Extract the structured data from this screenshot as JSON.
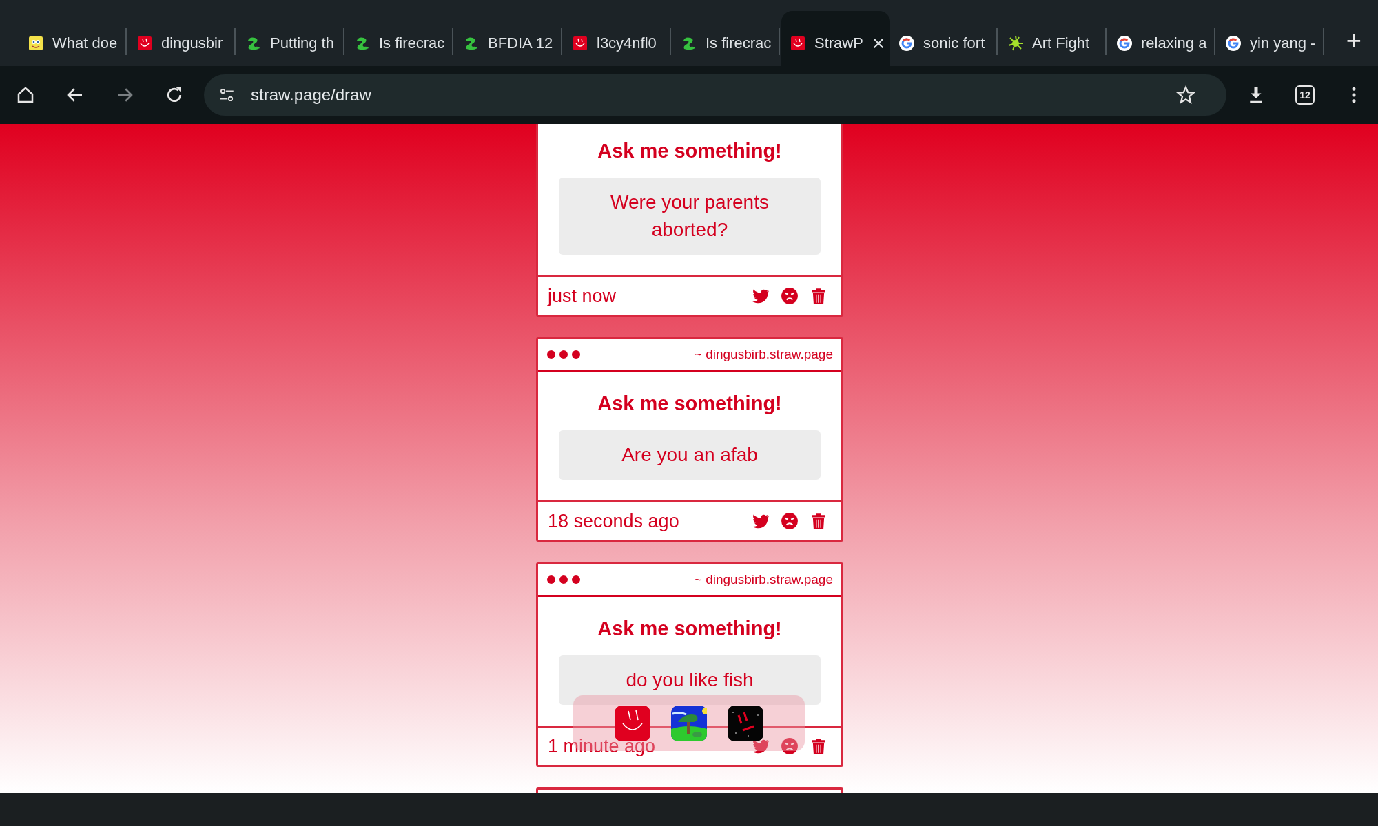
{
  "browser": {
    "tabs": [
      {
        "title": "What doe",
        "kind": "sponge",
        "selected": false
      },
      {
        "title": "dingusbir",
        "kind": "straw",
        "selected": false
      },
      {
        "title": "Putting th",
        "kind": "blob",
        "selected": false
      },
      {
        "title": "Is firecrac",
        "kind": "blob",
        "selected": false
      },
      {
        "title": "BFDIA 12",
        "kind": "blob",
        "selected": false
      },
      {
        "title": "l3cy4nfl0",
        "kind": "straw",
        "selected": false
      },
      {
        "title": "Is firecrac",
        "kind": "blob",
        "selected": false
      },
      {
        "title": "StrawP",
        "kind": "straw",
        "selected": true
      },
      {
        "title": "sonic fort",
        "kind": "google",
        "selected": false
      },
      {
        "title": "Art Fight",
        "kind": "splat",
        "selected": false
      },
      {
        "title": "relaxing a",
        "kind": "google",
        "selected": false
      },
      {
        "title": "yin yang -",
        "kind": "google",
        "selected": false
      }
    ],
    "new_tab": "+",
    "address": "straw.page/draw",
    "tab_count": "12"
  },
  "cards": [
    {
      "title": "Ask me something!",
      "question": "Were your parents aborted?",
      "time": "just now"
    },
    {
      "domain": "~ dingusbirb.straw.page",
      "title": "Ask me something!",
      "question": "Are you an afab",
      "time": "18 seconds ago"
    },
    {
      "domain": "~ dingusbirb.straw.page",
      "title": "Ask me something!",
      "question": "do you like fish",
      "time": "1 minute ago"
    }
  ],
  "dock": {
    "apps": [
      {
        "kind": "smile"
      },
      {
        "kind": "landscape"
      },
      {
        "kind": "frown"
      }
    ]
  }
}
